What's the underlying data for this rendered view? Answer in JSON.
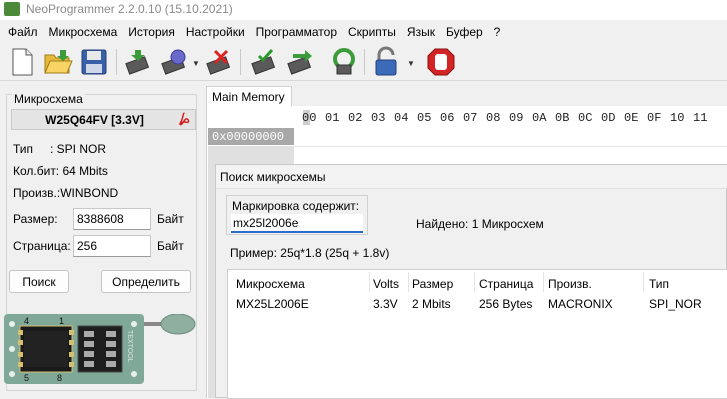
{
  "window": {
    "title": "NeoProgrammer 2.2.0.10 (15.10.2021)"
  },
  "menu": [
    "Файл",
    "Микросхема",
    "История",
    "Настройки",
    "Программатор",
    "Скрипты",
    "Язык",
    "Буфер",
    "?"
  ],
  "toolbar": {
    "buttons": [
      "new-file",
      "open-folder",
      "save",
      "read-chip",
      "verify-chip",
      "erase-chip",
      "write-chip",
      "blank-check",
      "auto-program",
      "protect-lock",
      "stop"
    ]
  },
  "chip_panel": {
    "title": "Микросхема",
    "chip_name": "W25Q64FV [3.3V]",
    "type_label": "Тип",
    "type_value": ": SPI NOR",
    "size_bits": "Кол.бит: 64 Mbits",
    "manufacturer": "Произв.:WINBOND",
    "size_label": "Размер:",
    "size_value": "8388608",
    "size_unit": "Байт",
    "page_label": "Страница:",
    "page_value": "256",
    "page_unit": "Байт",
    "search_button": "Поиск",
    "detect_button": "Определить"
  },
  "chip_image": {
    "pin1": "4",
    "pin2": "1",
    "pin3": "5",
    "pin4": "8",
    "board_text": "TEXTOOL"
  },
  "memory": {
    "tab_label": "Main Memory",
    "hex_columns": [
      "00",
      "01",
      "02",
      "03",
      "04",
      "05",
      "06",
      "07",
      "08",
      "09",
      "0A",
      "0B",
      "0C",
      "0D",
      "0E",
      "0F",
      "10",
      "11"
    ],
    "address": "0x00000000"
  },
  "search_dialog": {
    "title": "Поиск микросхемы",
    "label": "Маркировка содержит:",
    "input_value": "mx25l2006e",
    "found_text": "Найдено: 1 Микросхем",
    "example_text": "Пример:  25q*1.8 (25q + 1.8v)",
    "headers": [
      "Микросхема",
      "Volts",
      "Размер",
      "Страница",
      "Произв.",
      "Тип"
    ],
    "rows": [
      [
        "MX25L2006E",
        "3.3V",
        "2 Mbits",
        "256 Bytes",
        "MACRONIX",
        "SPI_NOR"
      ]
    ]
  }
}
